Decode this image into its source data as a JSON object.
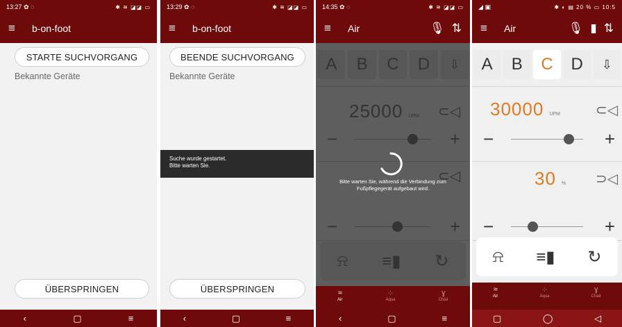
{
  "screen1": {
    "time": "13:27",
    "status_icons": "✱ ≋ ◪◪ ▭",
    "title": "b-on-foot",
    "start_button": "STARTE SUCHVORGANG",
    "known_devices": "Bekannte Geräte",
    "skip_button": "ÜBERSPRINGEN"
  },
  "screen2": {
    "time": "13:29",
    "status_icons": "✱ ≋ ◪◪ ▭",
    "title": "b-on-foot",
    "stop_button": "BEENDE SUCHVORGANG",
    "known_devices": "Bekannte Geräte",
    "toast_line1": "Suche wurde gestartet.",
    "toast_line2": "Bitte warten Sie.",
    "skip_button": "ÜBERSPRINGEN"
  },
  "screen3": {
    "time": "14:35",
    "status_icons": "✱ ≋ ◪◪ ▭",
    "title": "Air",
    "letters": [
      "A",
      "B",
      "C",
      "D"
    ],
    "speed_value": "25000",
    "speed_unit": "UPM",
    "loading_text_1": "Bitte warten Sie, während die Verbindung zum",
    "loading_text_2": "Fußpflegegerät aufgebaut wird."
  },
  "screen4": {
    "status_left": "◢ ▣",
    "status_right": "✱ ◐ ▤ 20 % ▭ 10:5",
    "title": "Air",
    "letters": [
      "A",
      "B",
      "C",
      "D"
    ],
    "active_letter": "C",
    "speed_value": "30000",
    "speed_unit": "UPM",
    "percent_value": "30",
    "percent_unit": "%"
  },
  "tabs": [
    {
      "label": "Air"
    },
    {
      "label": "Aqua"
    },
    {
      "label": "Chair"
    }
  ],
  "sliders": {
    "screen3_speed_level": 0.75,
    "screen3_percent_level": 0.55,
    "screen4_speed_level": 0.8,
    "screen4_percent_level": 0.3
  },
  "colors": {
    "brand": "#6e0a0a",
    "accent": "#e07a1f"
  },
  "icons": [
    "menu-icon",
    "microphone-icon",
    "sort-icon",
    "battery-icon",
    "download-icon",
    "handpiece-icon",
    "lamp-icon",
    "light-icon",
    "rotate-icon",
    "air-icon",
    "aqua-icon",
    "chair-icon",
    "back-icon",
    "home-icon",
    "recent-icon",
    "spinner-icon"
  ]
}
